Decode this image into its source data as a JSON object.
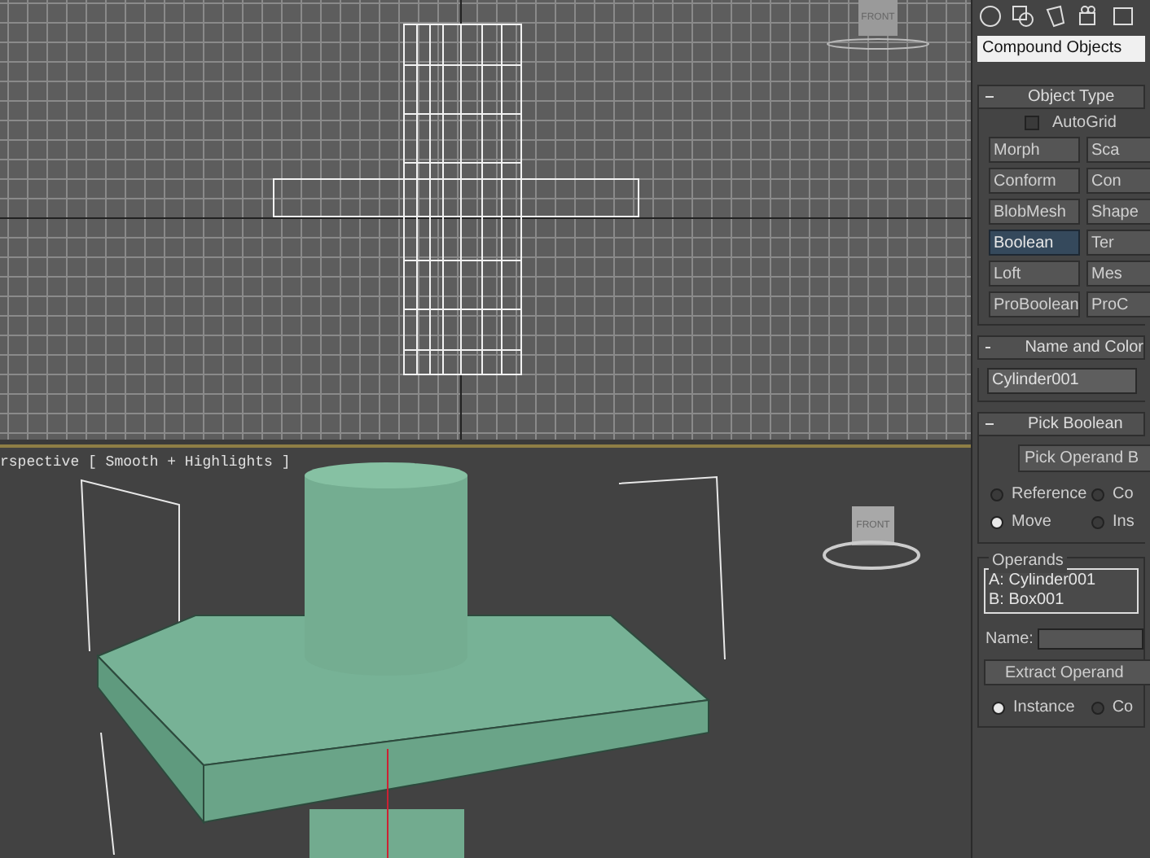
{
  "top_viewport": {
    "viewcube_label": "FRONT"
  },
  "perspective_viewport": {
    "label": "rspective [ Smooth + Highlights ]",
    "viewcube_label": "FRONT"
  },
  "command_panel": {
    "category_dropdown": "Compound Objects",
    "object_type": {
      "title": "Object Type",
      "autogrid": {
        "label": "AutoGrid",
        "checked": false
      },
      "buttons": [
        {
          "label": "Morph",
          "selected": false
        },
        {
          "label": "Sca",
          "selected": false
        },
        {
          "label": "Conform",
          "selected": false
        },
        {
          "label": "Con",
          "selected": false
        },
        {
          "label": "BlobMesh",
          "selected": false
        },
        {
          "label": "Shape",
          "selected": false
        },
        {
          "label": "Boolean",
          "selected": true
        },
        {
          "label": "Ter",
          "selected": false
        },
        {
          "label": "Loft",
          "selected": false
        },
        {
          "label": "Mes",
          "selected": false
        },
        {
          "label": "ProBoolean",
          "selected": false
        },
        {
          "label": "ProC",
          "selected": false
        }
      ]
    },
    "name_and_color": {
      "title": "Name and Color",
      "name": "Cylinder001"
    },
    "pick_boolean": {
      "title": "Pick Boolean",
      "button": "Pick Operand B",
      "options": [
        {
          "label": "Reference",
          "selected": false
        },
        {
          "label": "Co",
          "selected": false
        },
        {
          "label": "Move",
          "selected": true
        },
        {
          "label": "Ins",
          "selected": false
        }
      ]
    },
    "operands": {
      "title": "Operands",
      "items": [
        "A: Cylinder001",
        "B: Box001"
      ],
      "name_label": "Name:",
      "extract_button": "Extract Operand",
      "options": [
        {
          "label": "Instance",
          "selected": true
        },
        {
          "label": "Co",
          "selected": false
        }
      ]
    }
  }
}
